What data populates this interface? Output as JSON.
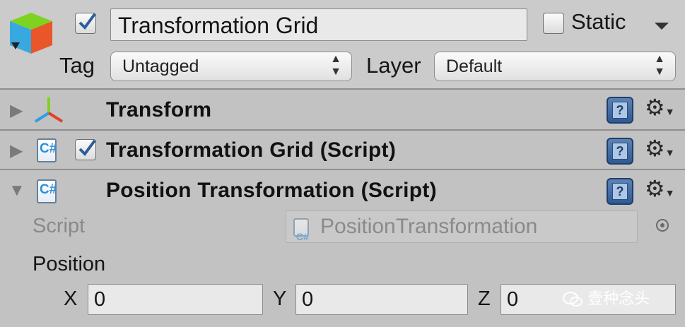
{
  "header": {
    "active": true,
    "name_value": "Transformation Grid",
    "static_label": "Static",
    "static_checked": false,
    "tag_label": "Tag",
    "tag_value": "Untagged",
    "layer_label": "Layer",
    "layer_value": "Default"
  },
  "components": [
    {
      "title": "Transform",
      "expanded": false,
      "icon": "transform-axes-icon"
    },
    {
      "title": "Transformation Grid (Script)",
      "expanded": false,
      "enabled": true,
      "icon": "csharp-script-icon"
    },
    {
      "title": "Position Transformation (Script)",
      "expanded": true,
      "icon": "csharp-script-icon"
    }
  ],
  "position_transformation": {
    "script_label": "Script",
    "script_value": "PositionTransformation",
    "position_label": "Position",
    "x_label": "X",
    "x_value": "0",
    "y_label": "Y",
    "y_value": "0",
    "z_label": "Z",
    "z_value": "0"
  },
  "watermark": "壹种念头",
  "colors": {
    "panel": "#c2c2c2",
    "header": "#cbcbcb",
    "field": "#e9e9e9",
    "check_blue": "#2c5d9c"
  }
}
